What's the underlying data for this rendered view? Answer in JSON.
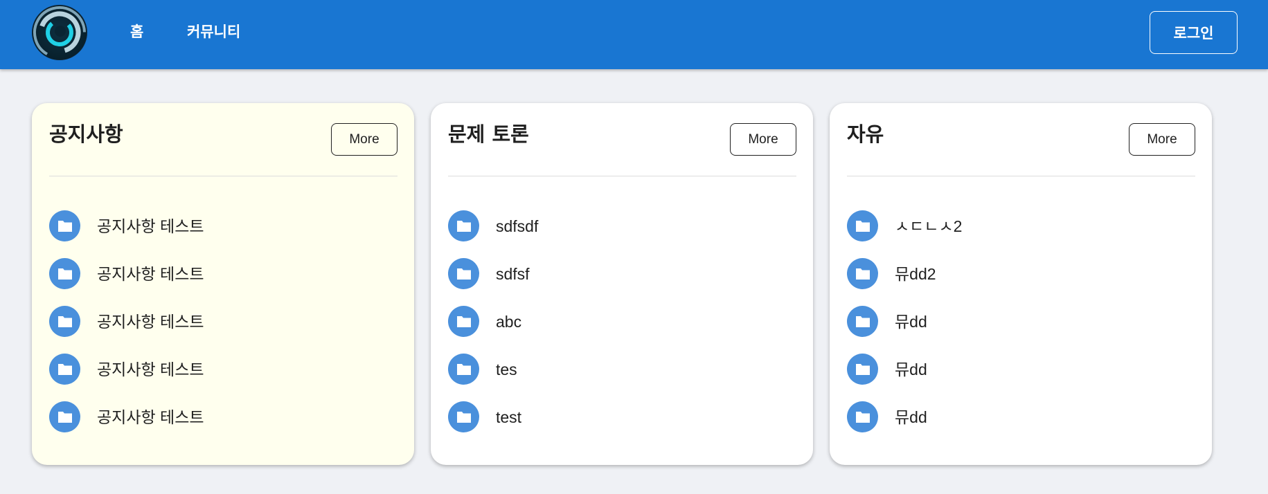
{
  "header": {
    "nav": [
      {
        "label": "홈"
      },
      {
        "label": "커뮤니티"
      }
    ],
    "login_label": "로그인"
  },
  "boards": [
    {
      "title": "공지사항",
      "more_label": "More",
      "posts": [
        "공지사항 테스트",
        "공지사항 테스트",
        "공지사항 테스트",
        "공지사항 테스트",
        "공지사항 테스트"
      ]
    },
    {
      "title": "문제 토론",
      "more_label": "More",
      "posts": [
        "sdfsdf",
        "sdfsf",
        "abc",
        "tes",
        "test"
      ]
    },
    {
      "title": "자유",
      "more_label": "More",
      "posts": [
        "ㅅㄷㄴㅅ2",
        "뮤dd2",
        "뮤dd",
        "뮤dd",
        "뮤dd"
      ]
    }
  ],
  "icons": {
    "post_icon": "folder-icon",
    "logo": "swirl-logo"
  },
  "colors": {
    "appbar": "#1976d2",
    "background": "#eff1f5",
    "notice_card": "#ffffee",
    "icon_circle": "#4a90dc"
  }
}
